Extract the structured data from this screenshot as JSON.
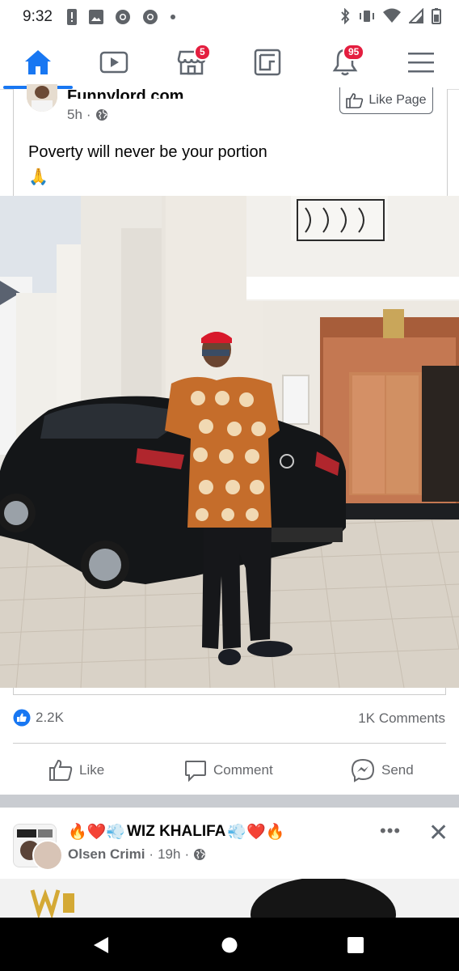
{
  "status_bar": {
    "time": "9:32"
  },
  "nav": {
    "marketplace_badge": "5",
    "notifications_badge": "95"
  },
  "post": {
    "page_name": "Funnylord.com",
    "time": "5h",
    "like_page_label": "Like Page",
    "text": "Poverty will never be your portion",
    "emoji": "🙏",
    "reaction_count": "2.2K",
    "comments_label": "1K Comments",
    "actions": {
      "like": "Like",
      "comment": "Comment",
      "send": "Send"
    }
  },
  "post2": {
    "title_prefix": "🔥❤️💨",
    "title_name": "WIZ KHALIFA",
    "title_suffix": "💨❤️🔥",
    "author": "Olsen Crimi",
    "time": "19h",
    "more_label": "•••",
    "close_label": "✕"
  },
  "colors": {
    "accent": "#1877f2",
    "badge": "#e41e3f",
    "secondary_text": "#65676b"
  },
  "icons": [
    "signal-icon",
    "wifi-icon",
    "battery-icon",
    "home-icon",
    "watch-icon",
    "marketplace-icon",
    "feeds-icon",
    "bell-icon",
    "menu-icon",
    "globe-icon",
    "thumbs-up-icon",
    "comment-icon",
    "messenger-icon",
    "back-icon",
    "home-circle-icon",
    "recents-icon"
  ]
}
